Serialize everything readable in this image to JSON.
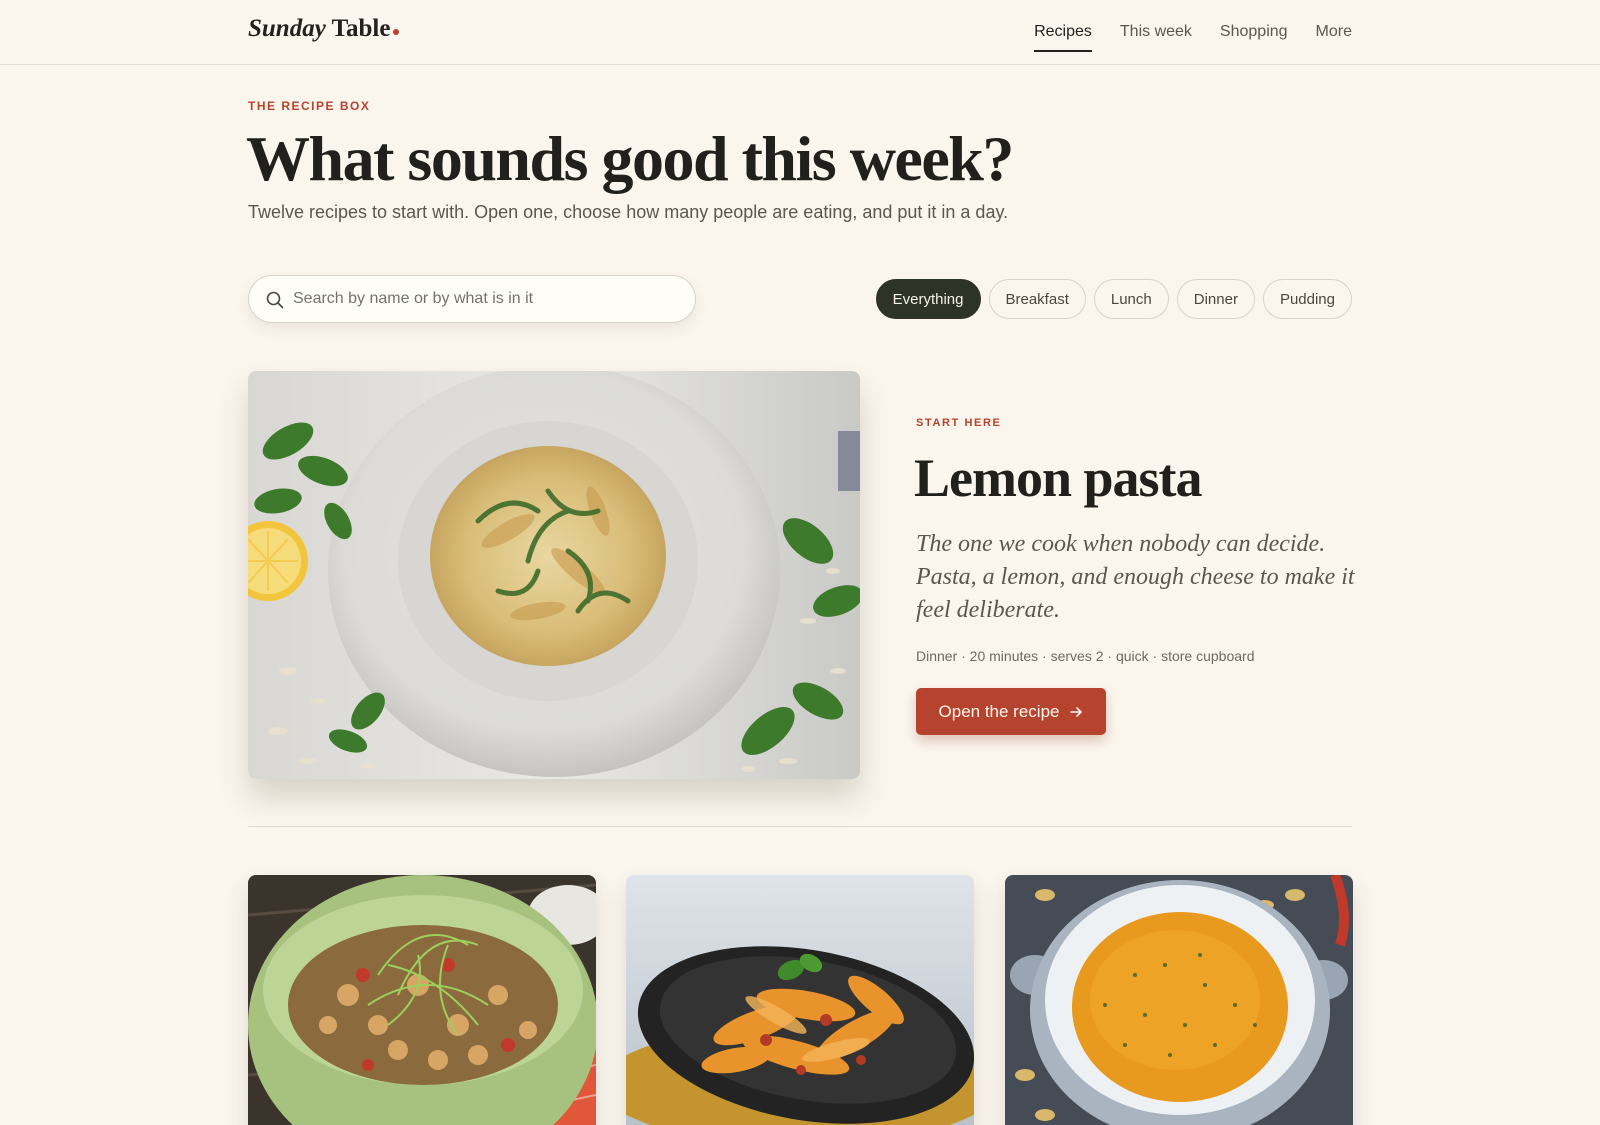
{
  "brand": {
    "name_italic": "Sunday",
    "name_rest": "Table"
  },
  "nav": {
    "items": [
      "Recipes",
      "This week",
      "Shopping",
      "More"
    ],
    "active": "Recipes"
  },
  "hero": {
    "eyebrow": "THE RECIPE BOX",
    "title": "What sounds good this week?",
    "subtitle": "Twelve recipes to start with. Open one, choose how many people are eating, and put it in a day."
  },
  "search": {
    "placeholder": "Search by name or by what is in it",
    "value": ""
  },
  "filters": {
    "options": [
      "Everything",
      "Breakfast",
      "Lunch",
      "Dinner",
      "Pudding"
    ],
    "selected": "Everything"
  },
  "featured": {
    "eyebrow": "START HERE",
    "title": "Lemon pasta",
    "description": "The one we cook when nobody can decide. Pasta, a lemon, and enough cheese to make it feel deliberate.",
    "meta": "Dinner · 20 minutes · serves 2 · quick · store cupboard",
    "button_label": "Open the recipe",
    "image_icon": "lemon-pasta-photo"
  },
  "cards": [
    {
      "image_icon": "chickpea-salad-photo"
    },
    {
      "image_icon": "tagliatelle-photo"
    },
    {
      "image_icon": "pumpkin-soup-photo"
    }
  ],
  "colors": {
    "background": "#faf6ee",
    "accent": "#b5432d",
    "chip_active": "#2e3327",
    "text": "#24231f"
  }
}
